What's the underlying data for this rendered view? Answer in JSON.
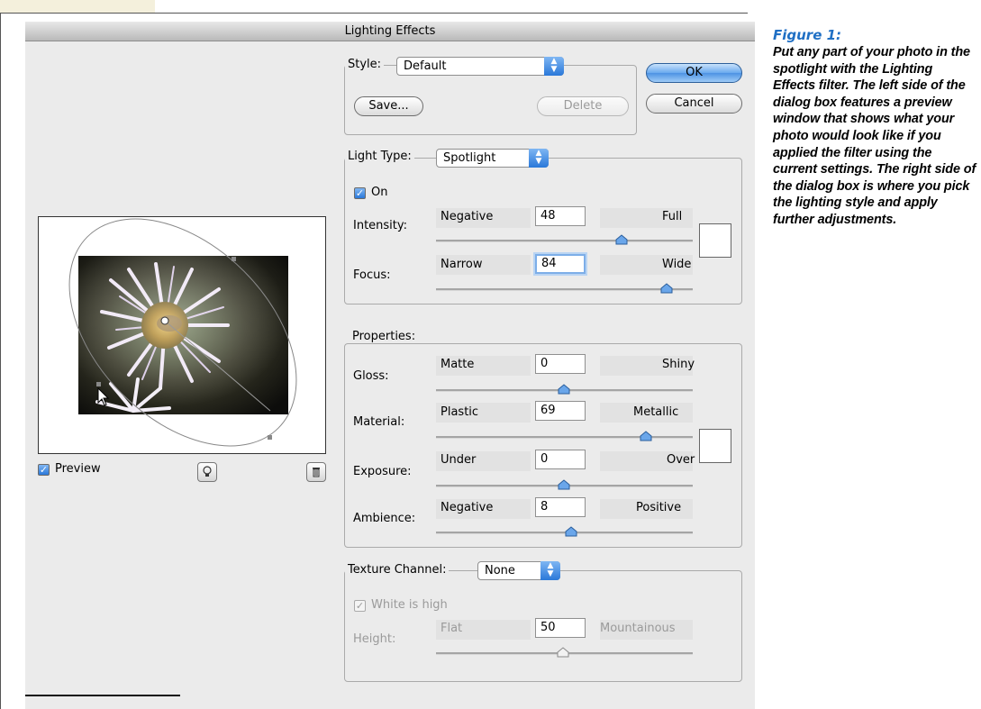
{
  "dialog": {
    "title": "Lighting Effects",
    "ok_label": "OK",
    "cancel_label": "Cancel"
  },
  "style": {
    "label": "Style:",
    "value": "Default",
    "save_label": "Save...",
    "delete_label": "Delete"
  },
  "light_type": {
    "label": "Light Type:",
    "value": "Spotlight",
    "on_label": "On",
    "on_checked": true
  },
  "intensity": {
    "label": "Intensity:",
    "left": "Negative",
    "right": "Full",
    "value": "48"
  },
  "focus": {
    "label": "Focus:",
    "left": "Narrow",
    "right": "Wide",
    "value": "84"
  },
  "properties": {
    "legend": "Properties:",
    "gloss": {
      "label": "Gloss:",
      "left": "Matte",
      "right": "Shiny",
      "value": "0"
    },
    "material": {
      "label": "Material:",
      "left": "Plastic",
      "right": "Metallic",
      "value": "69"
    },
    "exposure": {
      "label": "Exposure:",
      "left": "Under",
      "right": "Over",
      "value": "0"
    },
    "ambience": {
      "label": "Ambience:",
      "left": "Negative",
      "right": "Positive",
      "value": "8"
    }
  },
  "texture": {
    "label": "Texture Channel:",
    "value": "None",
    "white_is_high_label": "White is high",
    "height": {
      "label": "Height:",
      "left": "Flat",
      "right": "Mountainous",
      "value": "50"
    }
  },
  "preview": {
    "checkbox_label": "Preview",
    "checked": true
  },
  "caption": {
    "title": "Figure 1:",
    "body": "Put any part of your photo in the spotlight with the Lighting Effects filter. The left side of the dialog box features a preview window that shows what your photo would look like if you applied the filter using the current settings. The right side of the dialog box is where you pick the lighting style and apply further adjustments."
  },
  "colors": {
    "accent_blue": "#2a78d9",
    "caption_title": "#1f6fc4",
    "dialog_bg": "#ebebeb"
  },
  "icons": {
    "new_light": "lightbulb-icon",
    "delete_light": "trash-icon",
    "popup_arrows": "updown-arrows-icon"
  }
}
